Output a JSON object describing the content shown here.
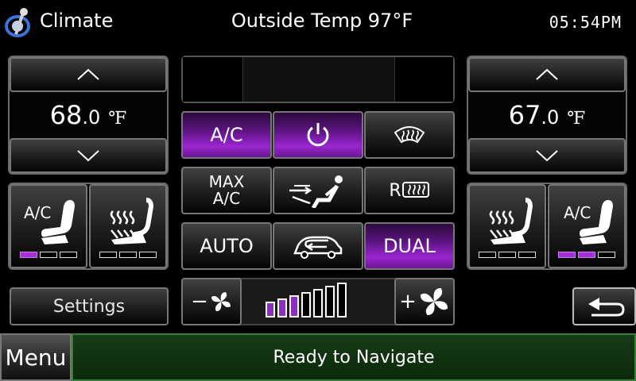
{
  "header": {
    "title": "Climate",
    "center": "Outside Temp 97°F",
    "clock": "05:54PM"
  },
  "left_zone": {
    "temp_int": "68",
    "temp_dec": ".0",
    "unit": "℉"
  },
  "right_zone": {
    "temp_int": "67",
    "temp_dec": ".0",
    "unit": "℉"
  },
  "left_seats": [
    {
      "label": "A/C",
      "icon": "seat-cool-icon",
      "level": 1,
      "max": 3
    },
    {
      "label": "",
      "icon": "seat-heat-icon",
      "level": 0,
      "max": 3
    }
  ],
  "right_seats": [
    {
      "label": "",
      "icon": "seat-heat-icon",
      "level": 0,
      "max": 3
    },
    {
      "label": "A/C",
      "icon": "seat-cool-icon",
      "level": 2,
      "max": 3
    }
  ],
  "controls": {
    "ac_label": "A/C",
    "max_ac_line1": "MAX",
    "max_ac_line2": "A/C",
    "auto_label": "AUTO",
    "dual_label": "DUAL",
    "rear_defrost_prefix": "R",
    "states": {
      "ac": true,
      "power": true,
      "front_defrost": false,
      "max_ac": false,
      "airflow": false,
      "rear_defrost": false,
      "auto": false,
      "recirc": false,
      "dual": true
    }
  },
  "fan": {
    "level": 3,
    "max": 7
  },
  "settings_label": "Settings",
  "menu_label": "Menu",
  "status_text": "Ready to Navigate",
  "colors": {
    "active": "#9a26d0",
    "status_bg": "#163a16"
  }
}
